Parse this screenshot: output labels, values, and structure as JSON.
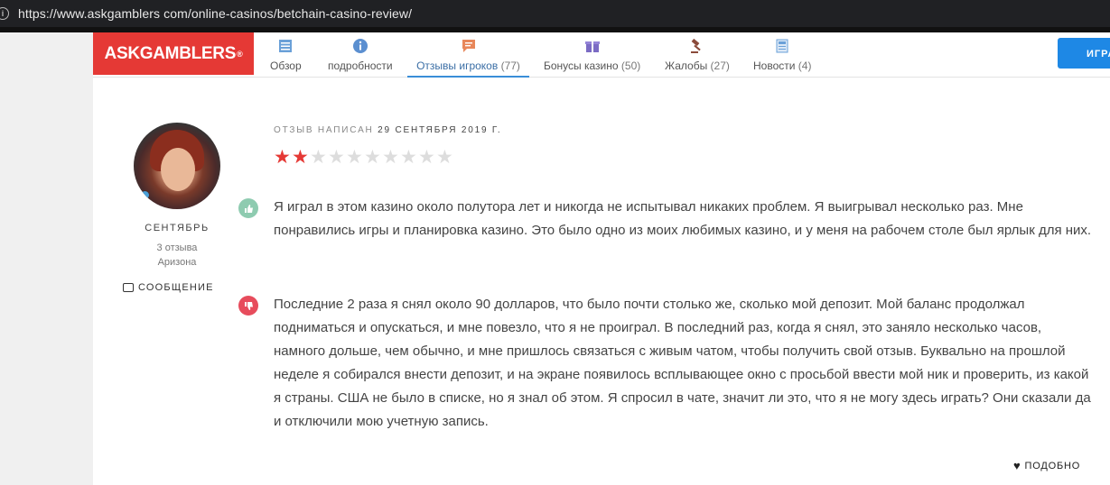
{
  "browser": {
    "url": "https://www.askgamblers com/online-casinos/betchain-casino-review/"
  },
  "brand": {
    "name": "ASKGAMBLERS",
    "mark": "®"
  },
  "nav": {
    "tabs": [
      {
        "label": "Обзор",
        "count": "",
        "icon": "list-icon"
      },
      {
        "label": "подробности",
        "count": "",
        "icon": "info-icon"
      },
      {
        "label": "Отзывы игроков",
        "count": "(77)",
        "icon": "comment-icon"
      },
      {
        "label": "Бонусы казино",
        "count": "(50)",
        "icon": "gift-icon"
      },
      {
        "label": "Жалобы",
        "count": "(27)",
        "icon": "gavel-icon"
      },
      {
        "label": "Новости",
        "count": "(4)",
        "icon": "news-icon"
      }
    ],
    "cta_label": "ИГРА"
  },
  "colors": {
    "brand_red": "#e53935",
    "accent_blue": "#1e88e5",
    "positive": "#8ecbb0",
    "negative": "#e74c5c"
  },
  "reviewer": {
    "name": "СЕНТЯБРЬ",
    "reviews": "3 отзыва",
    "location": "Аризона",
    "message_label": "СООБЩЕНИЕ"
  },
  "review": {
    "date_prefix": "ОТЗЫВ НАПИСАН",
    "date": "29 СЕНТЯБРЯ 2019 Г.",
    "rating": 2,
    "rating_max": 10,
    "positive": "Я играл в этом казино около полутора лет и никогда не испытывал никаких проблем. Я выигрывал несколько раз. Мне понравились игры и планировка казино. Это было одно из моих любимых казино, и у меня на рабочем столе был ярлык для них.",
    "negative": "Последние 2 раза я снял около 90 долларов, что было почти столько же, сколько мой депозит. Мой баланс продолжал подниматься и опускаться, и мне повезло, что я не проиграл. В последний раз, когда я снял, это заняло несколько часов, намного дольше, чем обычно, и мне пришлось связаться с живым чатом, чтобы получить свой отзыв. Буквально на прошлой неделе я собирался внести депозит, и на экране появилось всплывающее окно с просьбой ввести мой ник и проверить, из какой я страны. США не было в списке, но я знал об этом. Я спросил в чате, значит ли это, что я не могу здесь играть? Они сказали да и отключили мою учетную запись.",
    "like_label": "ПОДОБНО"
  }
}
